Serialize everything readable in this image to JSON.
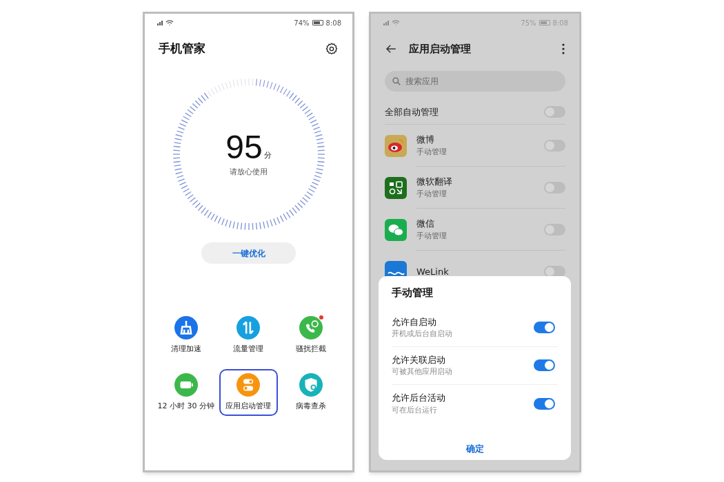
{
  "left_screen": {
    "status_bar": {
      "battery": "74%",
      "time": "8:08"
    },
    "title": "手机管家",
    "score": {
      "value": "95",
      "unit": "分",
      "caption": "请放心使用"
    },
    "optimize_button": "一键优化",
    "tools": [
      {
        "kind": "clean",
        "label": "清理加速",
        "selected": false,
        "dot": false
      },
      {
        "kind": "data",
        "label": "流量管理",
        "selected": false,
        "dot": false
      },
      {
        "kind": "block",
        "label": "骚扰拦截",
        "selected": false,
        "dot": true
      },
      {
        "kind": "battery",
        "label": "12 小时 30 分钟",
        "selected": false,
        "dot": false
      },
      {
        "kind": "startup",
        "label": "应用启动管理",
        "selected": true,
        "dot": false
      },
      {
        "kind": "virus",
        "label": "病毒查杀",
        "selected": false,
        "dot": false
      }
    ]
  },
  "right_screen": {
    "status_bar": {
      "battery": "75%",
      "time": "8:08"
    },
    "title": "应用启动管理",
    "search": {
      "placeholder": "搜索应用"
    },
    "all_auto": {
      "label": "全部自动管理",
      "on": false
    },
    "apps": [
      {
        "kind": "weibo",
        "name": "微博",
        "mode": "手动管理",
        "on": false
      },
      {
        "kind": "translator",
        "name": "微软翻译",
        "mode": "手动管理",
        "on": false
      },
      {
        "kind": "wechat",
        "name": "微信",
        "mode": "手动管理",
        "on": false
      },
      {
        "kind": "welink",
        "name": "WeLink",
        "on": false
      }
    ],
    "dialog": {
      "title": "手动管理",
      "options": [
        {
          "label": "允许自启动",
          "description": "开机或后台自启动",
          "on": true
        },
        {
          "label": "允许关联启动",
          "description": "可被其他应用启动",
          "on": true
        },
        {
          "label": "允许后台活动",
          "description": "可在后台运行",
          "on": true
        }
      ],
      "confirm": "确定"
    }
  }
}
